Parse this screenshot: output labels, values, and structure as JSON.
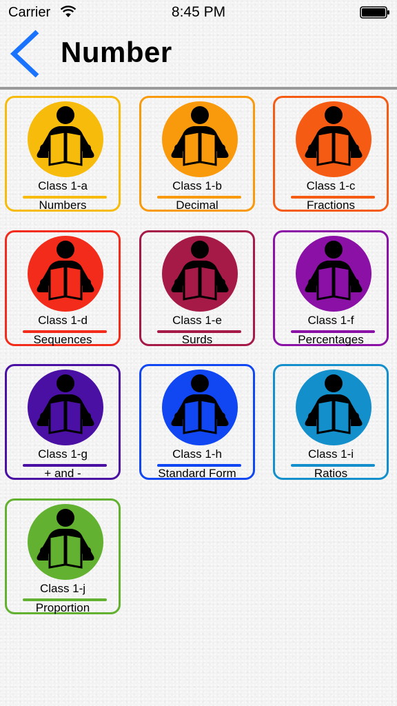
{
  "status_bar": {
    "carrier": "Carrier",
    "time": "8:45 PM"
  },
  "nav": {
    "title": "Number",
    "back_icon": "chevron-left-icon",
    "accent": "#1a73ff"
  },
  "tile_icon": "reader-icon",
  "tiles": [
    {
      "class_label": "Class 1-a",
      "topic": "Numbers",
      "color": "#f7bb0c"
    },
    {
      "class_label": "Class 1-b",
      "topic": "Decimal",
      "color": "#f99a0c"
    },
    {
      "class_label": "Class 1-c",
      "topic": "Fractions",
      "color": "#f65b14"
    },
    {
      "class_label": "Class 1-d",
      "topic": "Sequences",
      "color": "#f22b1b"
    },
    {
      "class_label": "Class 1-e",
      "topic": "Surds",
      "color": "#a51a46"
    },
    {
      "class_label": "Class 1-f",
      "topic": "Percentages",
      "color": "#8a10a6"
    },
    {
      "class_label": "Class 1-g",
      "topic": "+ and -",
      "color": "#4a0fa3"
    },
    {
      "class_label": "Class 1-h",
      "topic": "Standard Form",
      "color": "#1047f2"
    },
    {
      "class_label": "Class 1-i",
      "topic": "Ratios",
      "color": "#138fcc"
    },
    {
      "class_label": "Class 1-j",
      "topic": "Proportion",
      "color": "#62b130"
    }
  ]
}
